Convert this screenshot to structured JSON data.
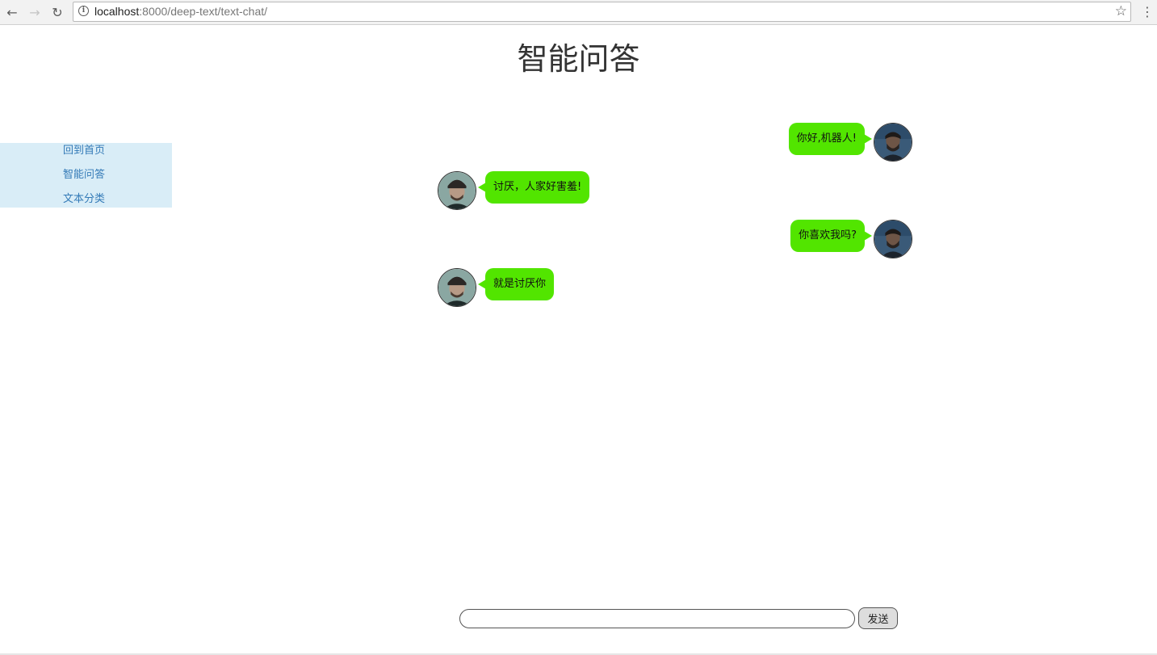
{
  "browser": {
    "url_host": "localhost",
    "url_rest": ":8000/deep-text/text-chat/",
    "back_icon": "arrow-left-icon",
    "forward_icon": "arrow-right-icon",
    "reload_icon": "reload-icon",
    "info_icon": "info-icon",
    "bookmark_icon": "star-icon",
    "menu_icon": "kebab-menu-icon"
  },
  "page": {
    "title": "智能问答"
  },
  "sidebar": {
    "items": [
      {
        "label": "回到首页"
      },
      {
        "label": "智能问答"
      },
      {
        "label": "文本分类"
      }
    ]
  },
  "chat": {
    "bubble_color": "#52e500",
    "messages": [
      {
        "side": "right",
        "text": "你好,机器人!"
      },
      {
        "side": "left",
        "text": "讨厌，人家好害羞!"
      },
      {
        "side": "right",
        "text": "你喜欢我吗?"
      },
      {
        "side": "left",
        "text": "就是讨厌你"
      }
    ]
  },
  "input": {
    "value": "",
    "placeholder": "",
    "send_label": "发送"
  }
}
